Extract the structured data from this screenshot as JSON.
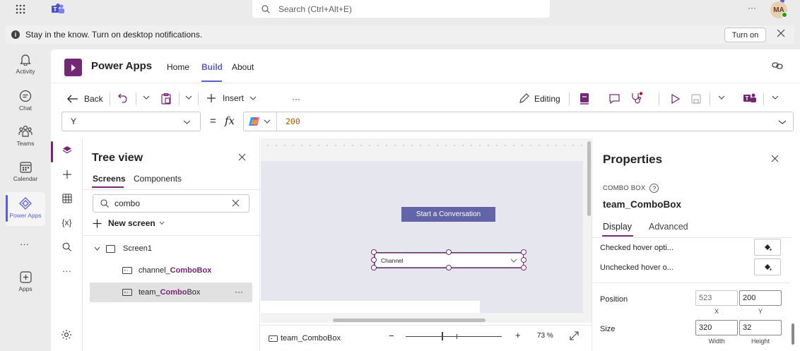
{
  "search": {
    "placeholder": "Search (Ctrl+Alt+E)"
  },
  "avatar": {
    "initials": "MA"
  },
  "notification": {
    "text": "Stay in the know. Turn on desktop notifications.",
    "button": "Turn on"
  },
  "rail": {
    "items": [
      {
        "label": "Activity",
        "icon": "bell-icon"
      },
      {
        "label": "Chat",
        "icon": "chat-icon"
      },
      {
        "label": "Teams",
        "icon": "teams-icon"
      },
      {
        "label": "Calendar",
        "icon": "calendar-icon"
      },
      {
        "label": "Power Apps",
        "icon": "powerapps-icon",
        "active": true
      },
      {
        "label": "Apps",
        "icon": "apps-icon"
      }
    ]
  },
  "app": {
    "title": "Power Apps",
    "nav": [
      "Home",
      "Build",
      "About"
    ],
    "active_nav": "Build"
  },
  "toolbar": {
    "back": "Back",
    "insert": "Insert",
    "more": "···",
    "editing": "Editing"
  },
  "formula": {
    "property": "Y",
    "fx": "fx",
    "equals": "=",
    "value": "200"
  },
  "tree": {
    "title": "Tree view",
    "tabs": [
      "Screens",
      "Components"
    ],
    "search_value": "combo",
    "new_screen": "New screen",
    "screen": "Screen1",
    "items": [
      {
        "prefix": "channel_",
        "match": "ComboBox",
        "suffix": ""
      },
      {
        "prefix": "team_",
        "match": "Combo",
        "suffix": "Box",
        "selected": true
      }
    ],
    "item_more": "···"
  },
  "canvas": {
    "button_label": "Start a Conversation",
    "combo_text": "Channel",
    "status_control": "team_ComboBox",
    "zoom": "73",
    "zoom_unit": "%",
    "zoom_minus": "−",
    "zoom_plus": "+"
  },
  "properties": {
    "title": "Properties",
    "type": "COMBO BOX",
    "name": "team_ComboBox",
    "tabs": [
      "Display",
      "Advanced"
    ],
    "rows": [
      {
        "label": "Checked hover opti..."
      },
      {
        "label": "Unchecked hover o..."
      }
    ],
    "position": {
      "label": "Position",
      "x": "523",
      "y": "200",
      "x_cap": "X",
      "y_cap": "Y"
    },
    "size": {
      "label": "Size",
      "w": "320",
      "h": "32",
      "w_cap": "Width",
      "h_cap": "Height"
    }
  }
}
